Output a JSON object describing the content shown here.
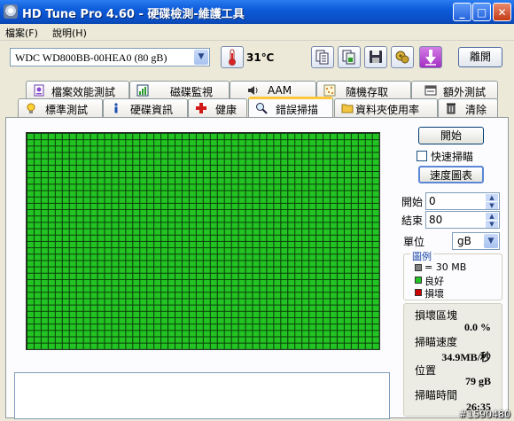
{
  "window": {
    "title": "HD Tune Pro 4.60 - 硬碟檢測-維護工具",
    "minimize_glyph": "_",
    "maximize_glyph": "□",
    "close_glyph": "✕"
  },
  "menu": {
    "items": [
      {
        "label": "檔案(F)"
      },
      {
        "label": "說明(H)"
      }
    ]
  },
  "toolbar": {
    "drive": "WDC WD800BB-00HEA0 (80 gB)",
    "temperature": "31℃",
    "exit_label": "離開",
    "icons": [
      "copy-text-icon",
      "copy-screenshot-icon",
      "save-icon",
      "options-icon",
      "download-icon"
    ]
  },
  "tabs": {
    "row1": [
      {
        "label": "檔案效能測試",
        "icon": "file-benchmark-icon"
      },
      {
        "label": "磁碟監視",
        "icon": "disk-monitor-icon"
      },
      {
        "label": "AAM",
        "icon": "speaker-icon"
      },
      {
        "label": "隨機存取",
        "icon": "random-access-icon"
      },
      {
        "label": "額外測試",
        "icon": "extra-tests-icon"
      }
    ],
    "row2": [
      {
        "label": "標準測試",
        "icon": "lightbulb-icon"
      },
      {
        "label": "硬碟資訊",
        "icon": "info-icon"
      },
      {
        "label": "健康",
        "icon": "health-cross-icon"
      },
      {
        "label": "錯誤掃描",
        "icon": "magnifier-icon",
        "active": true
      },
      {
        "label": "資料夾使用率",
        "icon": "folder-icon"
      },
      {
        "label": "清除",
        "icon": "trash-icon"
      }
    ]
  },
  "scan": {
    "start_label": "開始",
    "quick_scan_label": "快速掃瞄",
    "quick_scan_checked": false,
    "speed_map_label": "速度圖表",
    "start_field_label": "開始",
    "start_value": "0",
    "end_field_label": "結束",
    "end_value": "80",
    "unit_label": "單位",
    "unit_value": "gB",
    "grid_cols": 50,
    "grid_rows": 34,
    "grid_color": "#22c322"
  },
  "legend": {
    "title": "圖例",
    "items": [
      {
        "label": "= 30 MB",
        "color": "#808080"
      },
      {
        "label": "良好",
        "color": "#22c322"
      },
      {
        "label": "損壞",
        "color": "#cc0000"
      }
    ]
  },
  "stats": {
    "damaged_label": "損壞區塊",
    "damaged_value": "0.0 %",
    "speed_label": "掃瞄速度",
    "speed_value": "34.9MB/秒",
    "position_label": "位置",
    "position_value": "79 gB",
    "time_label": "掃瞄時間",
    "time_value": "26:35"
  },
  "watermark": "#1590480"
}
